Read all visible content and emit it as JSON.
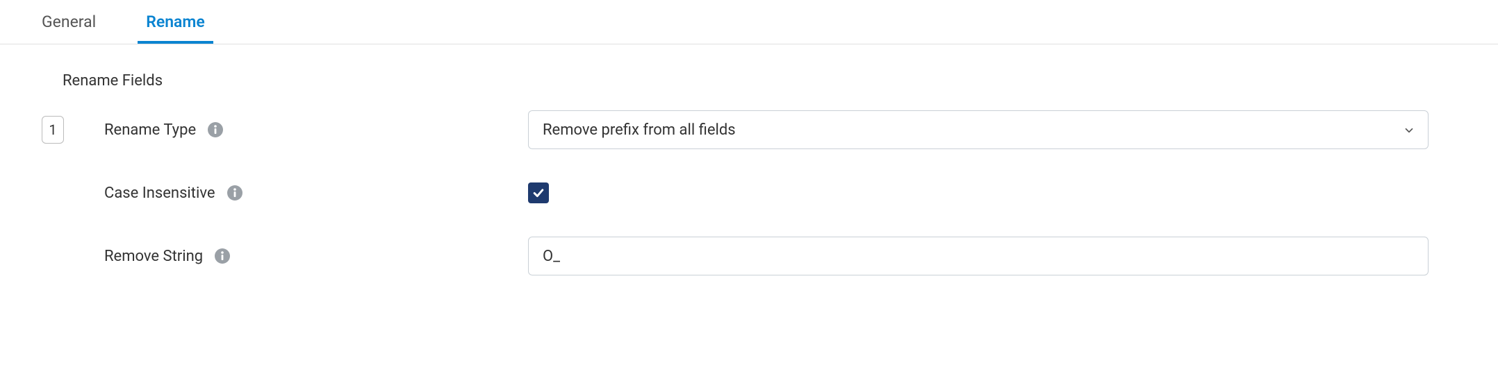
{
  "tabs": {
    "general": "General",
    "rename": "Rename",
    "active": "rename"
  },
  "section": {
    "title": "Rename Fields"
  },
  "row_index": "1",
  "fields": {
    "rename_type": {
      "label": "Rename Type",
      "value": "Remove prefix from all fields"
    },
    "case_insensitive": {
      "label": "Case Insensitive",
      "checked": true
    },
    "remove_string": {
      "label": "Remove String",
      "value": "O_"
    }
  },
  "colors": {
    "accent": "#0b84d1",
    "checkbox_bg": "#1e3a6e"
  }
}
